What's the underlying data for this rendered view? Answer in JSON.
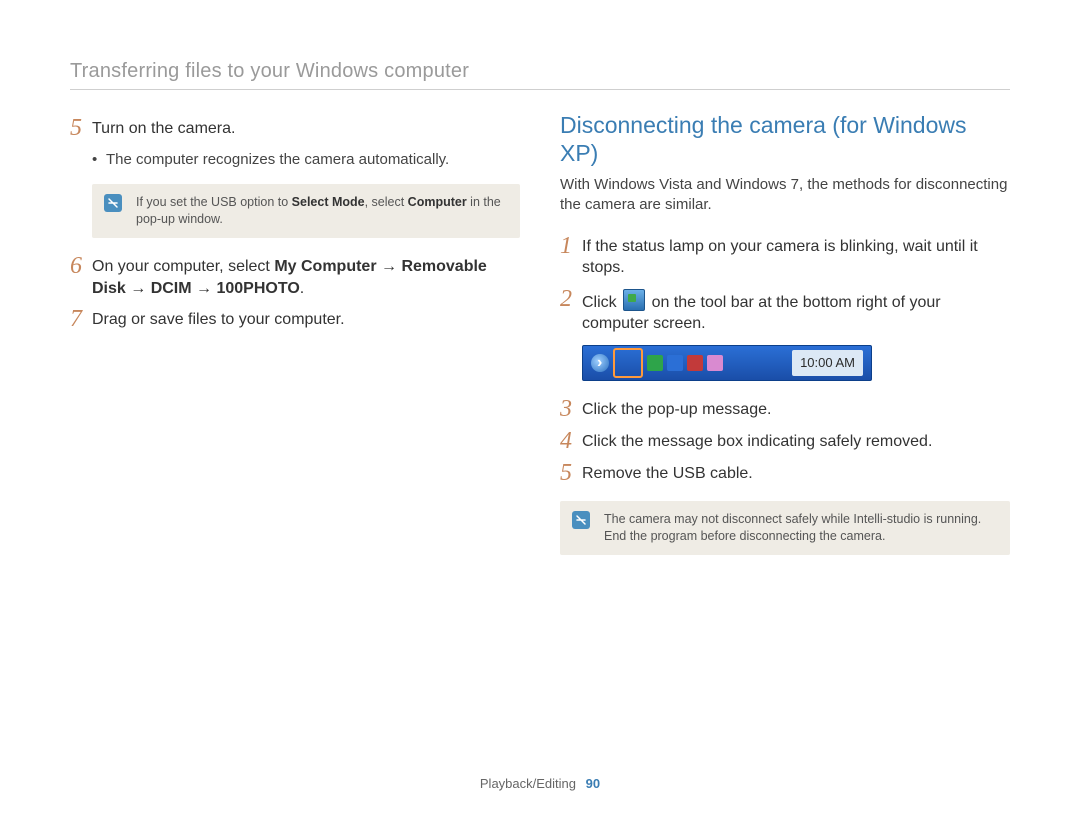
{
  "header": {
    "title": "Transferring files to your Windows computer"
  },
  "left": {
    "steps": [
      {
        "num": "5",
        "text": "Turn on the camera.",
        "bullet": "The computer recognizes the camera automatically.",
        "note_prefix": "If you set the USB option to ",
        "note_b1": "Select Mode",
        "note_mid": ", select ",
        "note_b2": "Computer",
        "note_suffix": " in the pop-up window."
      },
      {
        "num": "6",
        "text_prefix": "On your computer, select ",
        "b1": "My Computer",
        "arrow1": " → ",
        "b2": "Removable Disk",
        "arrow2": " → ",
        "b3": "DCIM",
        "arrow3": " → ",
        "b4": "100PHOTO",
        "text_suffix": "."
      },
      {
        "num": "7",
        "text": "Drag or save files to your computer."
      }
    ]
  },
  "right": {
    "heading": "Disconnecting the camera (for Windows XP)",
    "intro": "With Windows Vista and Windows 7, the methods for disconnecting the camera are similar.",
    "steps": [
      {
        "num": "1",
        "text": "If the status lamp on your camera is blinking, wait until it stops."
      },
      {
        "num": "2",
        "text_prefix": "Click ",
        "text_suffix": " on the tool bar at the bottom right of your computer screen."
      },
      {
        "num": "3",
        "text": "Click the pop-up message."
      },
      {
        "num": "4",
        "text": "Click the message box indicating safely removed."
      },
      {
        "num": "5",
        "text": "Remove the USB cable."
      }
    ],
    "tray_time": "10:00 AM",
    "note": "The camera may not disconnect safely while Intelli-studio is running. End the program before disconnecting the camera."
  },
  "footer": {
    "section": "Playback/Editing",
    "page": "90"
  }
}
